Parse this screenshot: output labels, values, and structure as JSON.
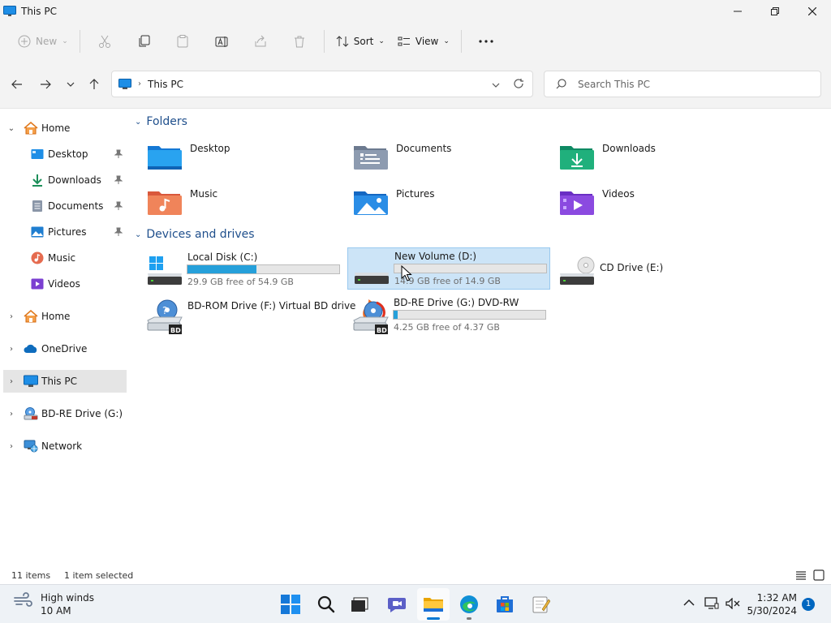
{
  "window": {
    "title": "This PC"
  },
  "commands": {
    "new": "New",
    "sort": "Sort",
    "view": "View"
  },
  "address": {
    "location": "This PC",
    "search_placeholder": "Search This PC"
  },
  "sidebar": {
    "items": [
      {
        "label": "Home"
      },
      {
        "label": "Desktop"
      },
      {
        "label": "Downloads"
      },
      {
        "label": "Documents"
      },
      {
        "label": "Pictures"
      },
      {
        "label": "Music"
      },
      {
        "label": "Videos"
      },
      {
        "label": "Home"
      },
      {
        "label": "OneDrive"
      },
      {
        "label": "This PC"
      },
      {
        "label": "BD-RE Drive (G:) DVD-RW"
      },
      {
        "label": "Network"
      }
    ]
  },
  "folders_section": {
    "title": "Folders"
  },
  "folders": [
    {
      "name": "Desktop"
    },
    {
      "name": "Documents"
    },
    {
      "name": "Downloads"
    },
    {
      "name": "Music"
    },
    {
      "name": "Pictures"
    },
    {
      "name": "Videos"
    }
  ],
  "drives_section": {
    "title": "Devices and drives"
  },
  "drives": [
    {
      "name": "Local Disk (C:)",
      "free": "29.9 GB free of 54.9 GB",
      "used_fraction": 0.455
    },
    {
      "name": "New Volume (D:)",
      "free": "14.9 GB free of 14.9 GB",
      "used_fraction": 0.0
    },
    {
      "name": "CD Drive (E:)"
    },
    {
      "name": "BD-ROM Drive (F:) Virtual BD drive"
    },
    {
      "name": "BD-RE Drive (G:) DVD-RW",
      "free": "4.25 GB free of 4.37 GB",
      "used_fraction": 0.027
    }
  ],
  "status": {
    "items": "11 items",
    "selected": "1 item selected"
  },
  "taskbar": {
    "weather_line1": "High winds",
    "weather_line2": "10 AM",
    "time": "1:32 AM",
    "date": "5/30/2024",
    "notifications": "1"
  },
  "colors": {
    "accent": "#0078d4",
    "selection": "#cce4f7",
    "drive_fill": "#26a0da",
    "section_header": "#1f4f8c"
  }
}
